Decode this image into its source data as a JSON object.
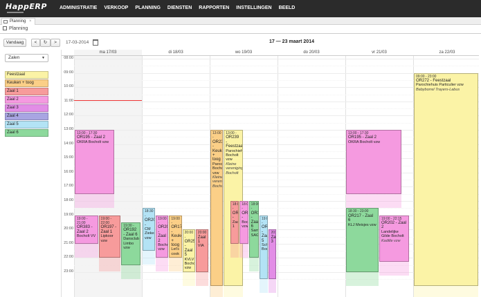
{
  "app": {
    "logo": "HappERP"
  },
  "nav": [
    "ADMINISTRATIE",
    "VERKOOP",
    "PLANNING",
    "DIENSTEN",
    "RAPPORTEN",
    "INSTELLINGEN",
    "BEELD"
  ],
  "tab": {
    "label": "Planning",
    "close": "×"
  },
  "breadcrumb": "Planning",
  "toolbar": {
    "today": "Vandaag",
    "prev": "<",
    "refresh": "↻",
    "next": ">",
    "date": "17-03-2014",
    "range": "17 — 23 maart 2014"
  },
  "filter": {
    "selected": "Zalen"
  },
  "legend": [
    {
      "label": "Feestzaal",
      "color": "#fbf3a6"
    },
    {
      "label": "Keuken + toog",
      "color": "#fbcf87"
    },
    {
      "label": "Zaal 1",
      "color": "#f79b9b"
    },
    {
      "label": "Zaal 2",
      "color": "#f59ae0"
    },
    {
      "label": "Zaal 3",
      "color": "#e28de6"
    },
    {
      "label": "Zaal 4",
      "color": "#a8a5e2"
    },
    {
      "label": "Zaal 5",
      "color": "#b3e3f5"
    },
    {
      "label": "Zaal 6",
      "color": "#8dd99c"
    }
  ],
  "days": [
    "ma 17/03",
    "di 18/03",
    "wo 19/03",
    "do 20/03",
    "vr 21/03",
    "za 22/03"
  ],
  "hours": [
    "08:00",
    "09:00",
    "10:00",
    "11:00",
    "12:00",
    "13:00",
    "14:00",
    "15:00",
    "16:00",
    "17:00",
    "18:00",
    "19:00",
    "20:00",
    "21:00",
    "22:00",
    "23:00"
  ],
  "events": [
    {
      "day": 0,
      "s": "13:00",
      "e": "17:30",
      "lane": 0,
      "lanes": 1,
      "w": 0.6,
      "room": "Zaal 2",
      "lines": [
        "13:00 - 17:30",
        "OR195 - Zaal 2",
        "OKRA Bocholt vzw"
      ]
    },
    {
      "day": 0,
      "s": "19:00",
      "e": "21:00",
      "lane": 0,
      "lanes": 1,
      "w": 0.36,
      "room": "Zaal 2",
      "lines": [
        "19:00 - 21:00",
        "OR383 - Zaal 2",
        "Bocholt VV"
      ]
    },
    {
      "day": 0,
      "s": "19:00",
      "e": "22:00",
      "lane": 1,
      "lanes": 1,
      "x": 0.36,
      "w": 0.34,
      "room": "Zaal 1",
      "lines": [
        "19:00 - 22:00",
        "OR197 - Zaal 1",
        "Lipkoor vzw"
      ]
    },
    {
      "day": 0,
      "s": "19:30",
      "e": "22:30",
      "lane": 0,
      "lanes": 1,
      "x": 0.7,
      "w": 0.3,
      "room": "Zaal 6",
      "lines": [
        "19:30 - ",
        "OR192 - Zaal 6",
        "Dansclub Limbo vzw"
      ]
    },
    {
      "day": 1,
      "s": "18:30",
      "e": "21:30",
      "lane": 0,
      "lanes": 1,
      "x": 0.0,
      "w": 0.2,
      "room": "Zaal 5",
      "lines": [
        "18:30 - ",
        "OR206 - ",
        "CM Ziekenzorg vzw"
      ]
    },
    {
      "day": 1,
      "s": "19:00",
      "e": "22:00",
      "lane": 0,
      "lanes": 1,
      "x": 0.2,
      "w": 0.2,
      "room": "Zaal 2",
      "lines": [
        "19:00 - ",
        "OR206 - Zaal 2",
        "Bocholt vzw"
      ]
    },
    {
      "day": 1,
      "s": "19:00",
      "e": "22:00",
      "lane": 0,
      "lanes": 1,
      "x": 0.4,
      "w": 0.2,
      "room": "Keuken + toog",
      "lines": [
        "19:00 - ",
        "OR176 - Keuken + toog",
        "Let's cook vzw"
      ]
    },
    {
      "day": 1,
      "s": "20:00",
      "e": "23:00",
      "lane": 0,
      "lanes": 1,
      "x": 0.6,
      "w": 0.2,
      "room": "Feestzaal",
      "lines": [
        "20:00 - ",
        "OR254 - Zaal 5",
        "KVLV Bocholt vzw"
      ]
    },
    {
      "day": 1,
      "s": "20:00",
      "e": "23:00",
      "lane": 0,
      "lanes": 1,
      "x": 0.8,
      "w": 0.2,
      "room": "Zaal 1",
      "lines": [
        "20:00",
        "Zaal 1",
        "VIA"
      ]
    },
    {
      "day": 2,
      "s": "13:00",
      "e": "24:00",
      "lane": 0,
      "lanes": 1,
      "x": 0.0,
      "w": 0.2,
      "room": "Keuken + toog",
      "lines": [
        "13:00 - ",
        "OR239 - Keuken + toog",
        "Parochiehuis Bocholt vzw",
        "Kleine vereniging Bocholt"
      ]
    },
    {
      "day": 2,
      "s": "13:00",
      "e": "24:00",
      "lane": 0,
      "lanes": 1,
      "x": 0.2,
      "w": 0.3,
      "room": "Feestzaal",
      "lines": [
        "13:00 - ",
        "OR239 - Feestzaal",
        "Parochiehuis Bocholt vzw",
        "Kleine vereniging Bocholt"
      ]
    },
    {
      "day": 2,
      "s": "18:00",
      "e": "21:00",
      "lane": 0,
      "lanes": 1,
      "x": 0.3,
      "w": 0.14,
      "room": "Zaal 1",
      "lines": [
        "18:00 - ",
        "OR385 - ",
        "Zaal 1"
      ]
    },
    {
      "day": 2,
      "s": "18:00",
      "e": "21:00",
      "lane": 0,
      "lanes": 1,
      "x": 0.44,
      "w": 0.14,
      "room": "Zaal 2",
      "lines": [
        "18:00 - ",
        "OR385 - ",
        "Bocholt vzw"
      ]
    },
    {
      "day": 2,
      "s": "18:00",
      "e": "22:00",
      "lane": 0,
      "lanes": 1,
      "x": 0.58,
      "w": 0.16,
      "room": "Zaal 6",
      "lines": [
        "18:00 - ",
        "OR369 - Zaal 6",
        "Samenleving SAGE"
      ]
    },
    {
      "day": 2,
      "s": "19:00",
      "e": "23:30",
      "lane": 0,
      "lanes": 1,
      "x": 0.74,
      "w": 0.14,
      "room": "Zaal 5",
      "lines": [
        "19:00 - ",
        "OR377 - Zaal 5",
        "Schutterij Bocholt"
      ]
    },
    {
      "day": 2,
      "s": "20:00",
      "e": "23:30",
      "lane": 0,
      "lanes": 1,
      "x": 0.88,
      "w": 0.12,
      "room": "Zaal 3",
      "lines": [
        "20:00",
        "Zaal 3"
      ]
    },
    {
      "day": 4,
      "s": "13:00",
      "e": "17:30",
      "lane": 0,
      "lanes": 1,
      "x": 0.0,
      "w": 0.84,
      "room": "Zaal 2",
      "lines": [
        "13:00 - 17:30",
        "OR195 - Zaal 2",
        "OKRA Bocholt vzw"
      ]
    },
    {
      "day": 4,
      "s": "18:30",
      "e": "23:00",
      "lane": 0,
      "lanes": 1,
      "x": 0.0,
      "w": 0.5,
      "room": "Zaal 6",
      "lines": [
        "18:30 - 23:00",
        "OR217 - Zaal 6",
        "KLJ Meisjes vzw"
      ]
    },
    {
      "day": 4,
      "s": "19:00",
      "e": "22:15",
      "lane": 0,
      "lanes": 1,
      "x": 0.5,
      "w": 0.46,
      "room": "Zaal 2",
      "lines": [
        "19:00 - 22:15",
        "OR202 - Zaal 2",
        "Landelijke Gilde Bocholt",
        "Kadille vzw"
      ]
    },
    {
      "day": 5,
      "s": "09:00",
      "e": "24:00",
      "lane": 0,
      "lanes": 1,
      "x": 0.0,
      "w": 0.98,
      "room": "Feestzaal",
      "lines": [
        "09:00 - 23:00",
        "OR272 - Feestzaal",
        "Parochiehuis Particulier vzw",
        "Babyborrel Trayers-Labus"
      ]
    }
  ]
}
